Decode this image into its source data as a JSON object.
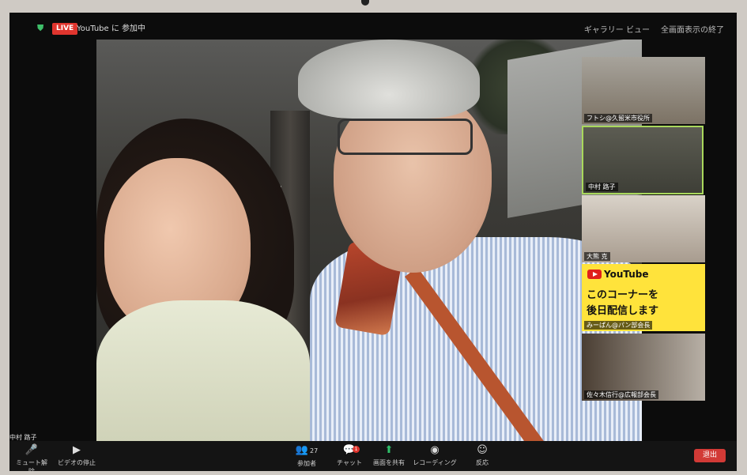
{
  "topbar": {
    "live_badge": "LIVE",
    "live_status": "YouTube に 参加中",
    "view_label": "ギャラリー ビュー",
    "fullscreen_label": "全画面表示の終了"
  },
  "self_name": "中村 路子",
  "gallery": [
    {
      "name": "フトシ@久留米市役所"
    },
    {
      "name": "中村 路子"
    },
    {
      "name": "大熊 克"
    },
    {
      "name": "みーぱん@パン部会長",
      "yt_word": "YouTube",
      "yt_line1": "このコーナーを",
      "yt_line2": "後日配信します"
    },
    {
      "name": "佐々木信行@広報部会長"
    }
  ],
  "toolbar": {
    "mute_label": "ミュート解除",
    "video_label": "ビデオの停止",
    "participants_label": "参加者",
    "participants_count": "27",
    "chat_label": "チャット",
    "chat_badge": "1",
    "share_label": "画面を共有",
    "record_label": "レコーディング",
    "reactions_label": "反応",
    "leave_label": "退出"
  },
  "colors": {
    "accent_live": "#e0352e",
    "share_green": "#2fc06a",
    "active_speaker_border": "#a9d85c",
    "youtube_banner": "#ffe33b"
  }
}
